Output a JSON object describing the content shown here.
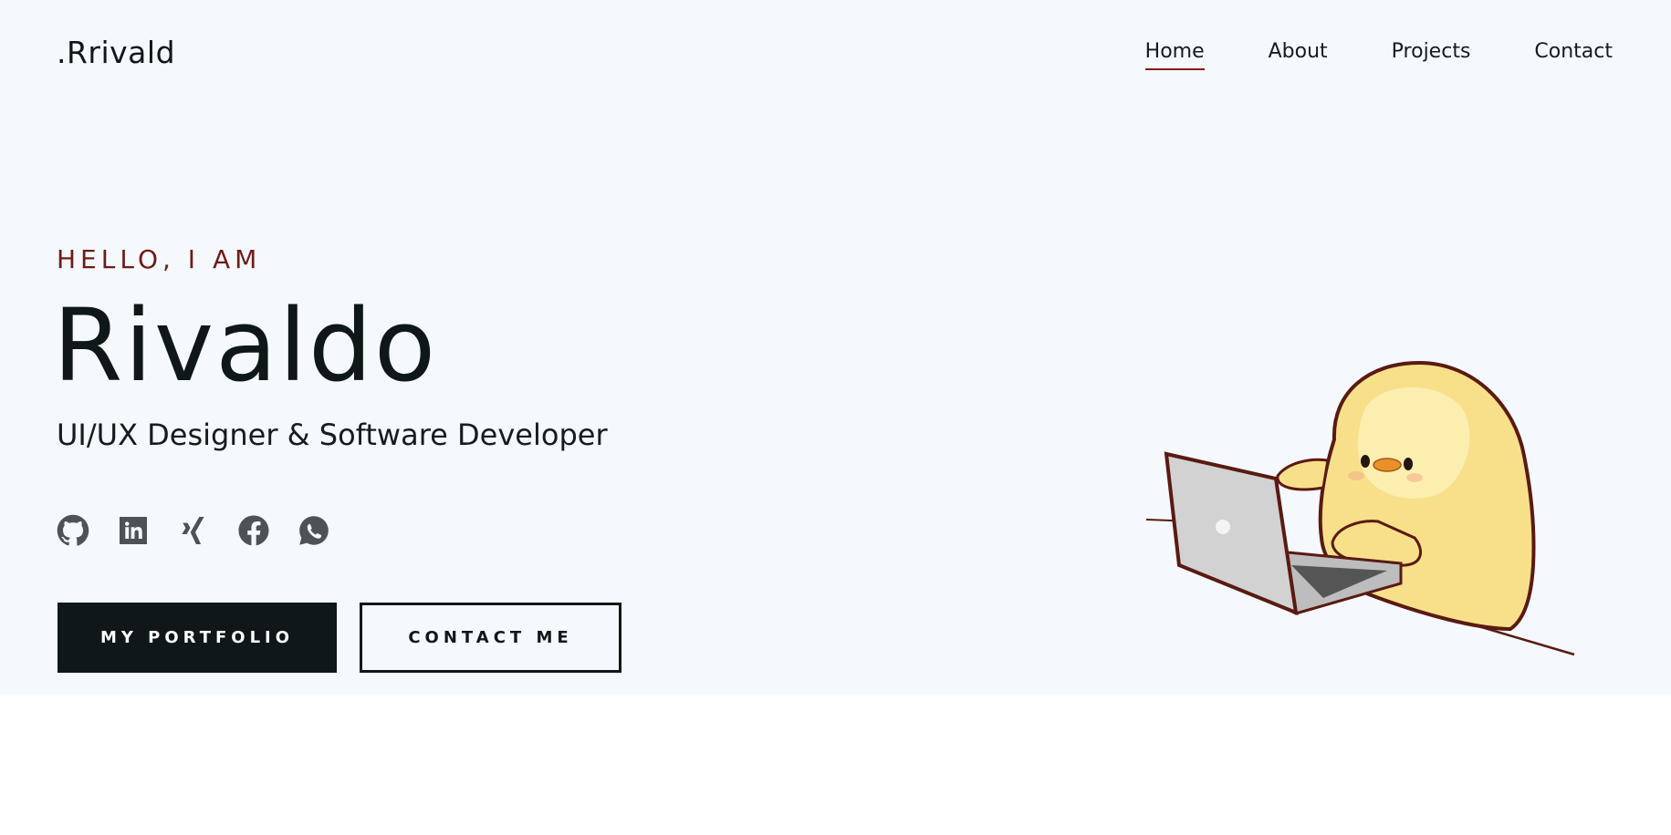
{
  "brand": {
    "logo_text": ".Rrivald"
  },
  "nav": {
    "items": [
      {
        "label": "Home",
        "active": true
      },
      {
        "label": "About",
        "active": false
      },
      {
        "label": "Projects",
        "active": false
      },
      {
        "label": "Contact",
        "active": false
      }
    ]
  },
  "hero": {
    "greeting": "HELLO, I AM",
    "name": "Rivaldo",
    "tagline": "UI/UX Designer & Software Developer",
    "buttons": {
      "primary_label": "MY PORTFOLIO",
      "secondary_label": "CONTACT ME"
    }
  },
  "socials": [
    {
      "icon": "github-icon"
    },
    {
      "icon": "linkedin-icon"
    },
    {
      "icon": "xing-icon"
    },
    {
      "icon": "facebook-icon"
    },
    {
      "icon": "whatsapp-icon"
    }
  ],
  "colors": {
    "hero_background": "#f5f9fd",
    "accent": "#8b1a14",
    "greeting": "#6f1b16",
    "text": "#0f1719",
    "icon": "#4d5254",
    "primary_button": "#0f1719"
  },
  "illustration": {
    "icon": "chick-typing-laptop-illustration"
  }
}
